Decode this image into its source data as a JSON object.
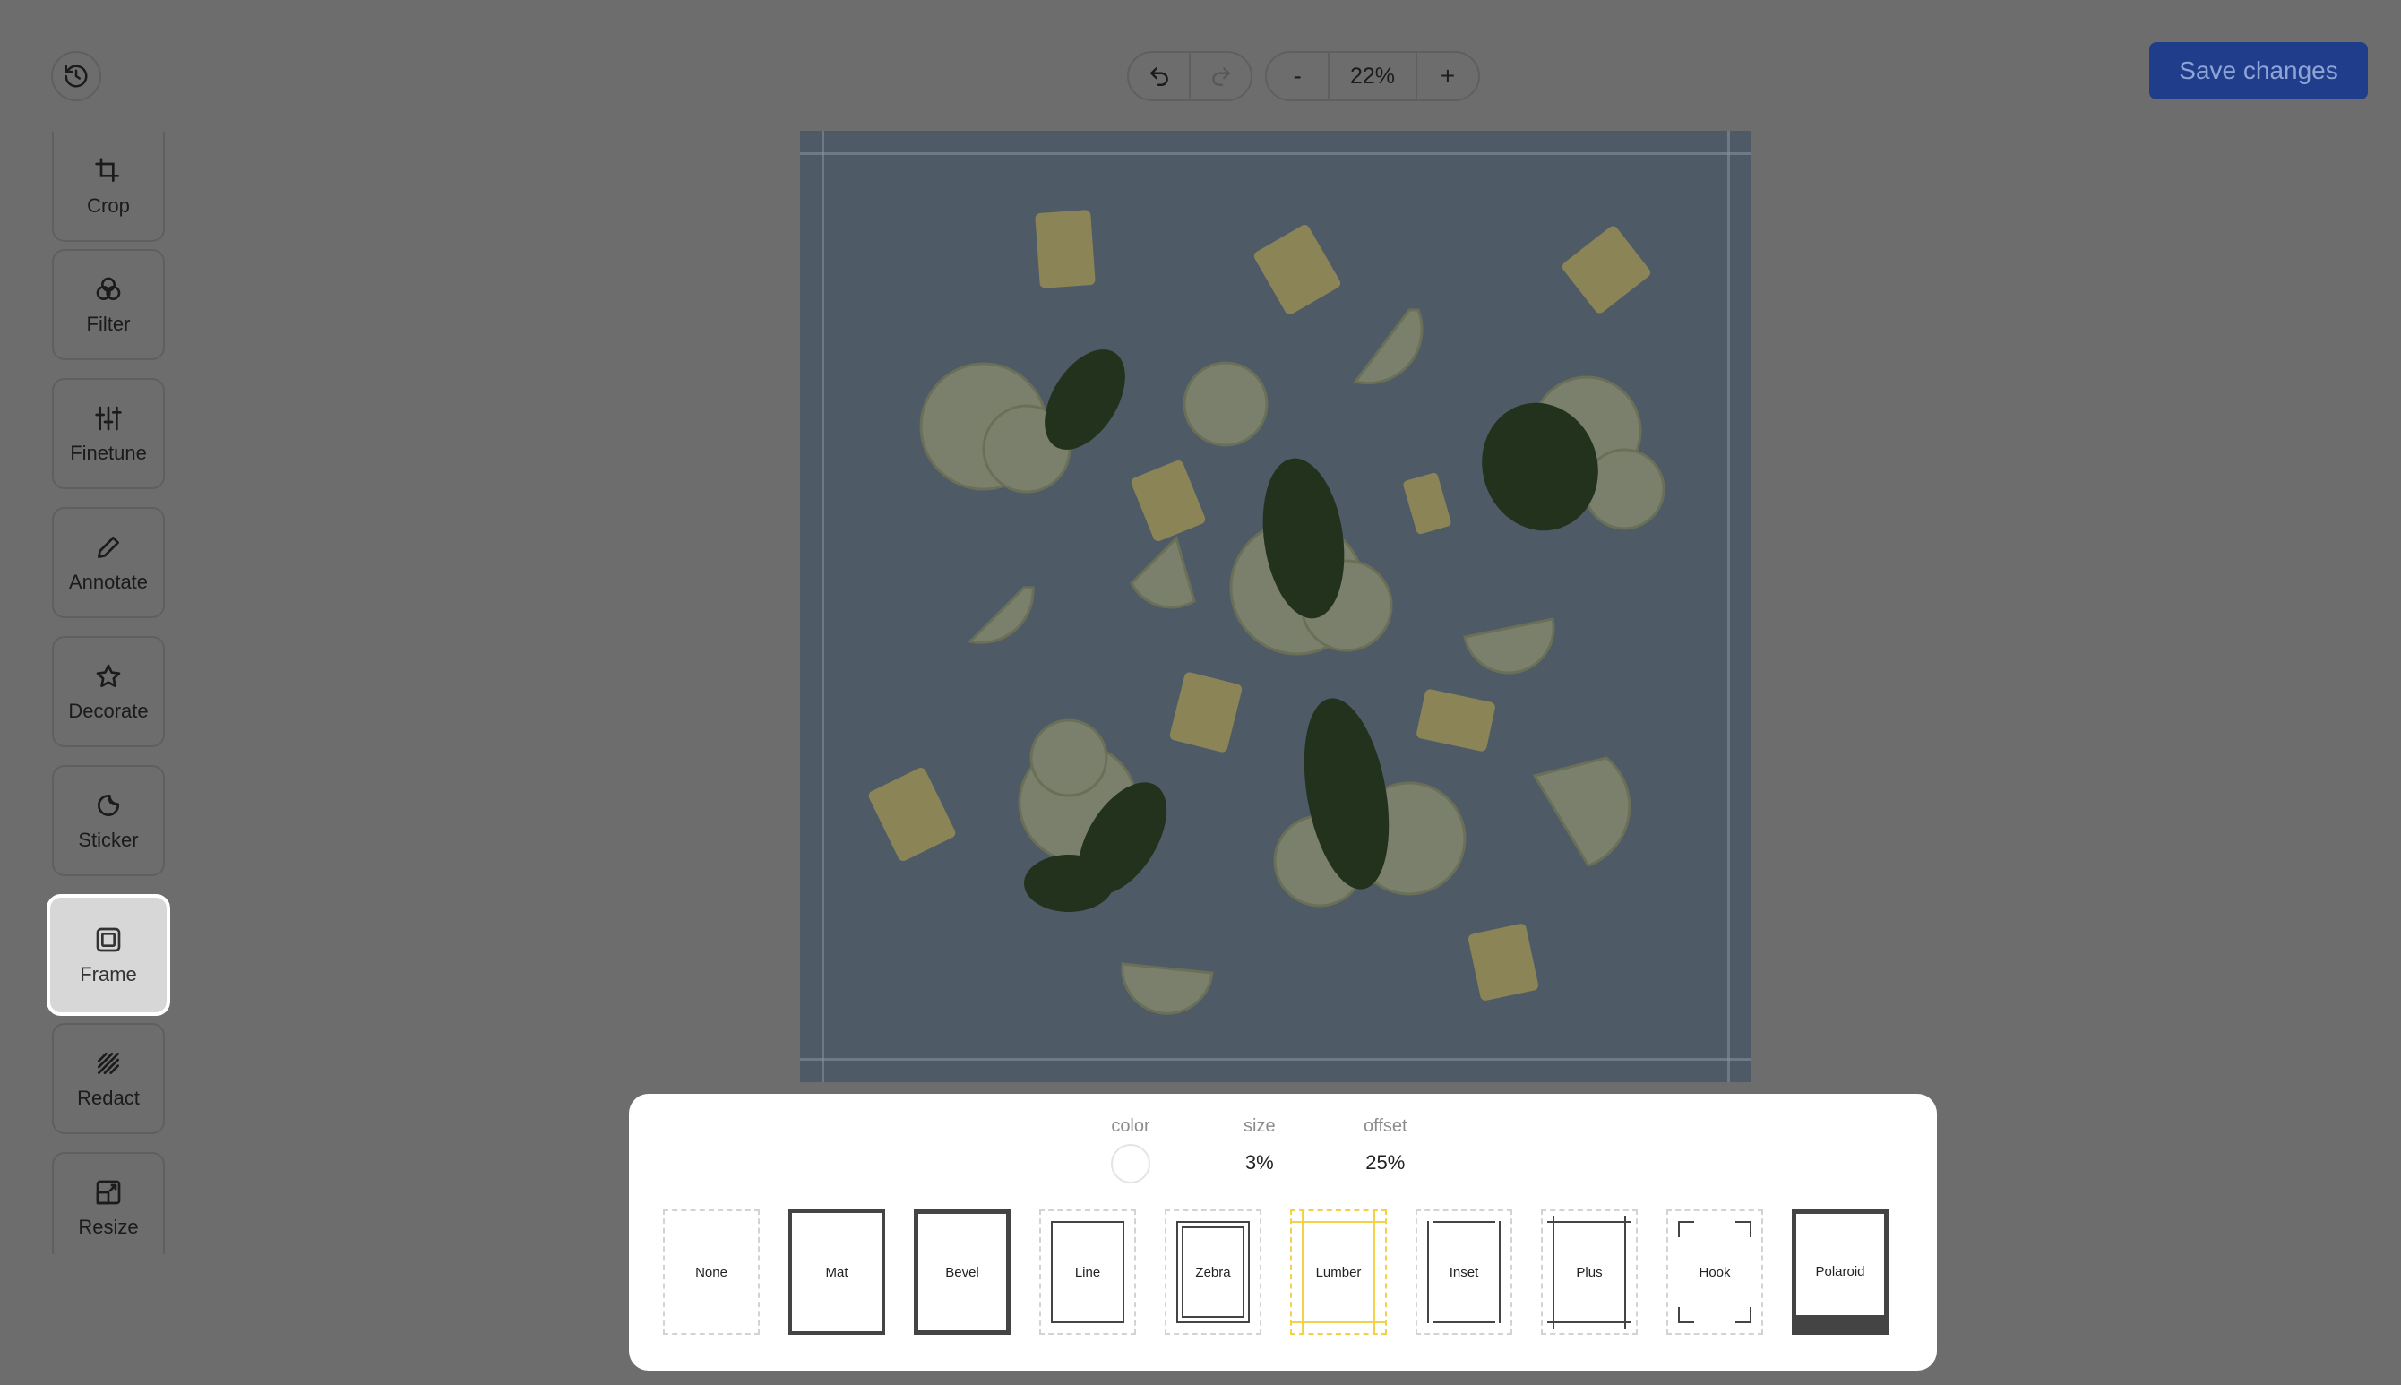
{
  "toolbar": {
    "history_icon": "history-icon",
    "undo_icon": "undo-icon",
    "redo_icon": "redo-icon",
    "zoom_out_label": "-",
    "zoom_value": "22%",
    "zoom_in_label": "+",
    "save_label": "Save changes"
  },
  "tools": [
    {
      "label": "Crop",
      "icon": "crop-icon"
    },
    {
      "label": "Filter",
      "icon": "filter-icon"
    },
    {
      "label": "Finetune",
      "icon": "sliders-icon"
    },
    {
      "label": "Annotate",
      "icon": "pencil-icon"
    },
    {
      "label": "Decorate",
      "icon": "star-icon"
    },
    {
      "label": "Sticker",
      "icon": "sticker-icon"
    },
    {
      "label": "Frame",
      "icon": "frame-icon",
      "active": true
    },
    {
      "label": "Redact",
      "icon": "redact-icon"
    },
    {
      "label": "Resize",
      "icon": "resize-icon"
    }
  ],
  "frame_panel": {
    "color_label": "color",
    "color_value": "#ffffff",
    "size_label": "size",
    "size_value": "3%",
    "offset_label": "offset",
    "offset_value": "25%",
    "options": [
      "None",
      "Mat",
      "Bevel",
      "Line",
      "Zebra",
      "Lumber",
      "Inset",
      "Plus",
      "Hook",
      "Polaroid"
    ],
    "selected": "Lumber"
  },
  "colors": {
    "accent": "#1f3d8a",
    "selected_outline": "#f2d24a",
    "canvas_bg": "#4e5966"
  }
}
